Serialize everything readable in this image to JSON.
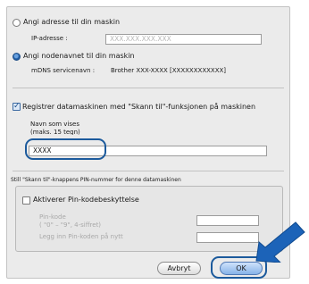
{
  "radio_address": {
    "label": "Angi adresse til din maskin",
    "selected": false
  },
  "ip_label": "IP-adresse :",
  "ip_placeholder": "XXX.XXX.XXX.XXX",
  "radio_node": {
    "label": "Angi nodenavnet til din maskin",
    "selected": true
  },
  "mdns_label": "mDNS servicenavn :",
  "mdns_value": "Brother XXX-XXXX   [XXXXXXXXXXXX]",
  "register_checkbox": {
    "label": "Registrer datamaskinen med \"Skann til\"-funksjonen på maskinen",
    "checked": true
  },
  "display_name_label_1": "Navn som vises",
  "display_name_label_2": "(maks. 15 tegn)",
  "display_name_value": "XXXX",
  "pin_section_label": "Still \"Skann til\"-knappens PIN-nummer for denne datamaskinen",
  "pin_checkbox": {
    "label": "Aktiverer Pin-kodebeskyttelse",
    "checked": false
  },
  "pin_label_1": "Pin-kode",
  "pin_label_2": "( \"0\" – \"9\", 4-siffret)",
  "pin_confirm_label": "Legg inn Pin-koden på nytt",
  "buttons": {
    "cancel": "Avbryt",
    "ok": "OK"
  },
  "colors": {
    "callout": "#1c5a9c",
    "arrow": "#1c63b8"
  }
}
